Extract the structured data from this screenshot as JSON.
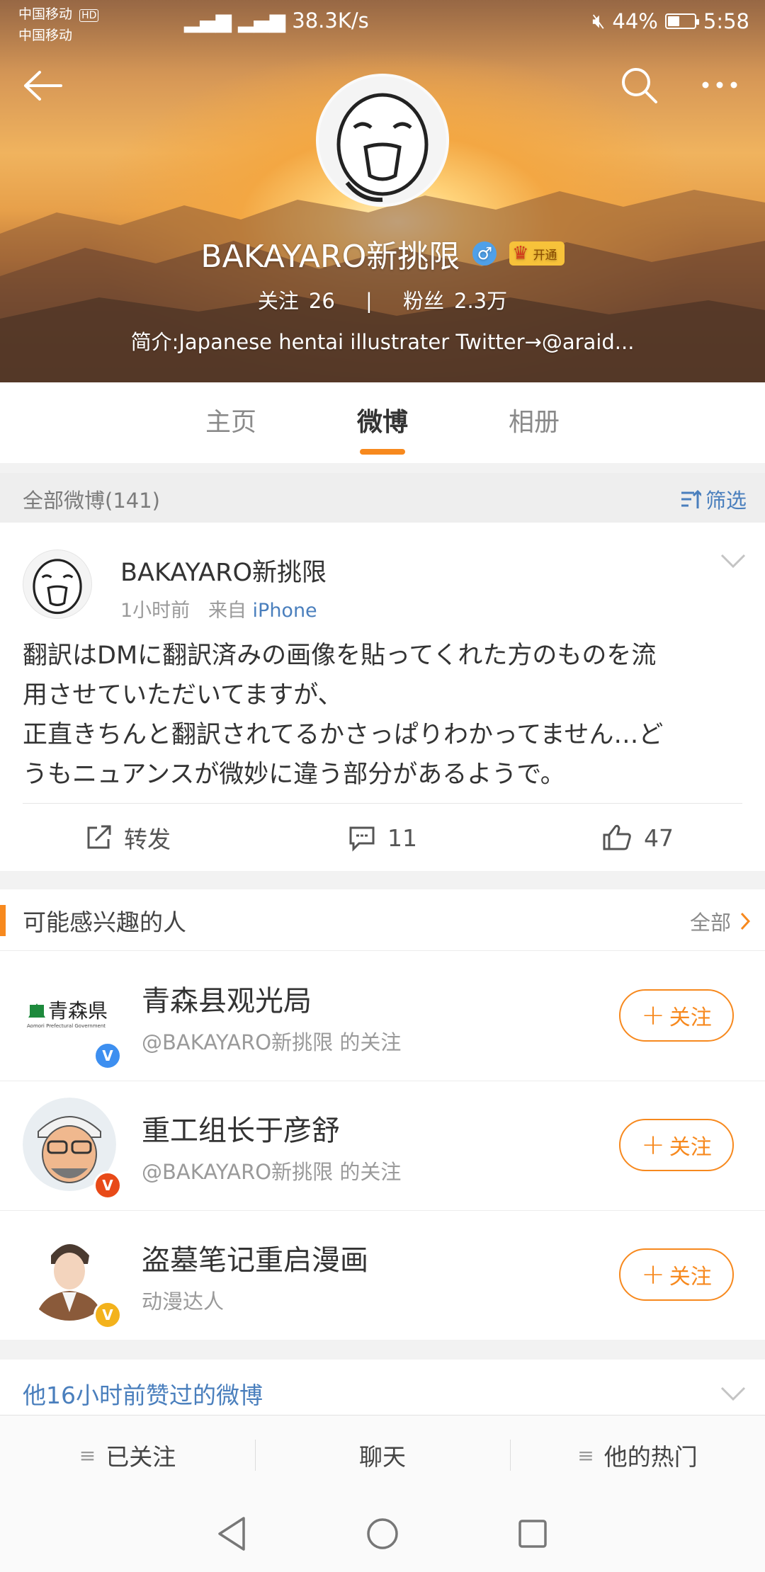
{
  "status_bar": {
    "carrier1": "中国移动",
    "carrier2": "中国移动",
    "net_badge": "HD",
    "speed": "38.3K/s",
    "battery": "44%",
    "battery_level": 0.44,
    "time": "5:58"
  },
  "profile": {
    "name": "BAKAYARO新挑限",
    "gender_icon": "♂",
    "vip_label": "开通",
    "following_label": "关注",
    "following_count": "26",
    "followers_label": "粉丝",
    "followers_count": "2.3万",
    "bio": "简介:Japanese hentai illustrater Twitter→@araid..."
  },
  "tabs": [
    {
      "label": "主页",
      "active": false
    },
    {
      "label": "微博",
      "active": true
    },
    {
      "label": "相册",
      "active": false
    }
  ],
  "filter_bar": {
    "count_label": "全部微博(141)",
    "filter_label": "筛选"
  },
  "post": {
    "author": "BAKAYARO新挑限",
    "time": "1小时前",
    "from": "来自",
    "source": "iPhone",
    "text_lines": [
      "翻訳はDMに翻訳済みの画像を貼ってくれた方のものを流",
      "用させていただいてますが、",
      "正直きちんと翻訳されてるかさっぱりわかってません…ど",
      "うもニュアンスが微妙に違う部分があるようで。"
    ],
    "repost_label": "转发",
    "comment_count": "11",
    "like_count": "47"
  },
  "suggestions": {
    "title": "可能感兴趣的人",
    "all_label": "全部",
    "follow_label": "关注",
    "items": [
      {
        "name": "青森县观光局",
        "sub": "@BAKAYARO新挑限 的关注",
        "badge": "V",
        "badge_color": "#3d8ff0",
        "logo_text": "青森県",
        "logo_sub": "Aomori Prefectural Government"
      },
      {
        "name": "重工组长于彦舒",
        "sub": "@BAKAYARO新挑限 的关注",
        "badge": "V",
        "badge_color": "#e84a18"
      },
      {
        "name": "盗墓笔记重启漫画",
        "sub": "动漫达人",
        "badge": "V",
        "badge_color": "#f3b21c"
      }
    ]
  },
  "liked": {
    "title": "他16小时前赞过的微博"
  },
  "toolbar": {
    "following": "已关注",
    "chat": "聊天",
    "hot": "他的热门"
  },
  "colors": {
    "accent": "#f7891e",
    "link": "#4a7fbd"
  }
}
